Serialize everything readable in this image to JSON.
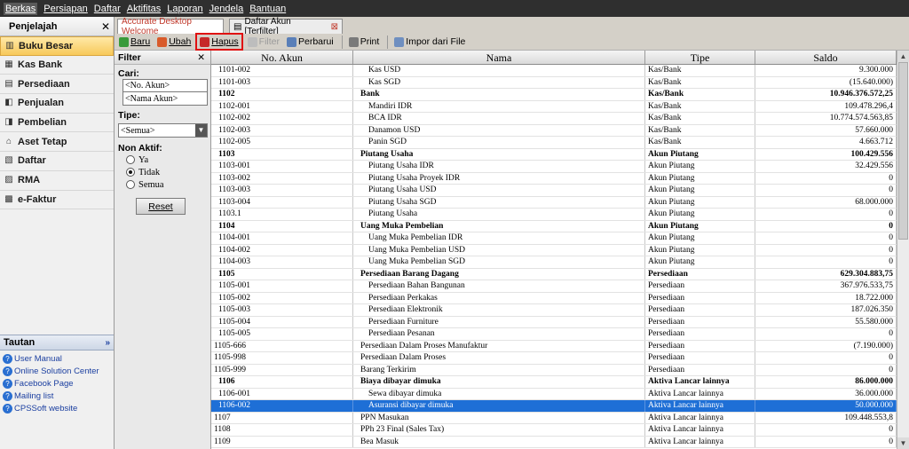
{
  "menu": [
    "Berkas",
    "Persiapan",
    "Daftar",
    "Aktifitas",
    "Laporan",
    "Jendela",
    "Bantuan"
  ],
  "leftnav": {
    "title": "Penjelajah",
    "items": [
      {
        "label": "Buku Besar",
        "icon": "ledger-icon",
        "active": true
      },
      {
        "label": "Kas Bank",
        "icon": "cash-bank-icon"
      },
      {
        "label": "Persediaan",
        "icon": "inventory-icon"
      },
      {
        "label": "Penjualan",
        "icon": "sales-icon"
      },
      {
        "label": "Pembelian",
        "icon": "purchase-icon"
      },
      {
        "label": "Aset Tetap",
        "icon": "fixed-asset-icon"
      },
      {
        "label": "Daftar",
        "icon": "list-icon"
      },
      {
        "label": "RMA",
        "icon": "rma-icon"
      },
      {
        "label": "e-Faktur",
        "icon": "efaktur-icon"
      }
    ],
    "tautan_title": "Tautan",
    "links": [
      "User Manual",
      "Online Solution Center",
      "Facebook Page",
      "Mailing list",
      "CPSSoft website"
    ]
  },
  "tabs": [
    "Accurate Desktop Welcome",
    "Daftar Akun [Terfilter]"
  ],
  "toolbar": {
    "baru": "Baru",
    "ubah": "Ubah",
    "hapus": "Hapus",
    "filter": "Filter",
    "perbarui": "Perbarui",
    "print": "Print",
    "impor": "Impor dari File"
  },
  "filter": {
    "title": "Filter",
    "cari_label": "Cari:",
    "no_akun": "<No. Akun>",
    "nama_akun": "<Nama Akun>",
    "tipe_label": "Tipe:",
    "tipe_value": "<Semua>",
    "nonaktif_label": "Non Aktif:",
    "opt_ya": "Ya",
    "opt_tidak": "Tidak",
    "opt_semua": "Semua",
    "reset": "Reset"
  },
  "grid": {
    "columns": [
      "No. Akun",
      "Nama",
      "Tipe",
      "Saldo"
    ],
    "rows": [
      {
        "no": "1101-002",
        "nama": "Kas USD",
        "tipe": "Kas/Bank",
        "saldo": "9.300.000",
        "lvl": 2
      },
      {
        "no": "1101-003",
        "nama": "Kas SGD",
        "tipe": "Kas/Bank",
        "saldo": "(15.640.000)",
        "lvl": 2
      },
      {
        "no": "1102",
        "nama": "Bank",
        "tipe": "Kas/Bank",
        "saldo": "10.946.376.572,25",
        "lvl": 1,
        "head": true
      },
      {
        "no": "1102-001",
        "nama": "Mandiri IDR",
        "tipe": "Kas/Bank",
        "saldo": "109.478.296,4",
        "lvl": 2
      },
      {
        "no": "1102-002",
        "nama": "BCA IDR",
        "tipe": "Kas/Bank",
        "saldo": "10.774.574.563,85",
        "lvl": 2
      },
      {
        "no": "1102-003",
        "nama": "Danamon USD",
        "tipe": "Kas/Bank",
        "saldo": "57.660.000",
        "lvl": 2
      },
      {
        "no": "1102-005",
        "nama": "Panin SGD",
        "tipe": "Kas/Bank",
        "saldo": "4.663.712",
        "lvl": 2
      },
      {
        "no": "1103",
        "nama": "Piutang Usaha",
        "tipe": "Akun Piutang",
        "saldo": "100.429.556",
        "lvl": 1,
        "head": true
      },
      {
        "no": "1103-001",
        "nama": "Piutang Usaha IDR",
        "tipe": "Akun Piutang",
        "saldo": "32.429.556",
        "lvl": 2
      },
      {
        "no": "1103-002",
        "nama": "Piutang Usaha Proyek IDR",
        "tipe": "Akun Piutang",
        "saldo": "0",
        "lvl": 2
      },
      {
        "no": "1103-003",
        "nama": "Piutang Usaha USD",
        "tipe": "Akun Piutang",
        "saldo": "0",
        "lvl": 2
      },
      {
        "no": "1103-004",
        "nama": "Piutang Usaha SGD",
        "tipe": "Akun Piutang",
        "saldo": "68.000.000",
        "lvl": 2
      },
      {
        "no": "1103.1",
        "nama": "Piutang Usaha",
        "tipe": "Akun Piutang",
        "saldo": "0",
        "lvl": 2
      },
      {
        "no": "1104",
        "nama": "Uang Muka Pembelian",
        "tipe": "Akun Piutang",
        "saldo": "0",
        "lvl": 1,
        "head": true
      },
      {
        "no": "1104-001",
        "nama": "Uang Muka Pembelian IDR",
        "tipe": "Akun Piutang",
        "saldo": "0",
        "lvl": 2
      },
      {
        "no": "1104-002",
        "nama": "Uang Muka Pembelian USD",
        "tipe": "Akun Piutang",
        "saldo": "0",
        "lvl": 2
      },
      {
        "no": "1104-003",
        "nama": "Uang Muka Pembelian SGD",
        "tipe": "Akun Piutang",
        "saldo": "0",
        "lvl": 2
      },
      {
        "no": "1105",
        "nama": "Persediaan Barang Dagang",
        "tipe": "Persediaan",
        "saldo": "629.304.883,75",
        "lvl": 1,
        "head": true
      },
      {
        "no": "1105-001",
        "nama": "Persediaan Bahan Bangunan",
        "tipe": "Persediaan",
        "saldo": "367.976.533,75",
        "lvl": 2
      },
      {
        "no": "1105-002",
        "nama": "Persediaan Perkakas",
        "tipe": "Persediaan",
        "saldo": "18.722.000",
        "lvl": 2
      },
      {
        "no": "1105-003",
        "nama": "Persediaan Elektronik",
        "tipe": "Persediaan",
        "saldo": "187.026.350",
        "lvl": 2
      },
      {
        "no": "1105-004",
        "nama": "Persediaan Furniture",
        "tipe": "Persediaan",
        "saldo": "55.580.000",
        "lvl": 2
      },
      {
        "no": "1105-005",
        "nama": "Persediaan Pesanan",
        "tipe": "Persediaan",
        "saldo": "0",
        "lvl": 2
      },
      {
        "no": "1105-666",
        "nama": "Persediaan Dalam Proses Manufaktur",
        "tipe": "Persediaan",
        "saldo": "(7.190.000)",
        "lvl": 0
      },
      {
        "no": "1105-998",
        "nama": "Persediaan Dalam Proses",
        "tipe": "Persediaan",
        "saldo": "0",
        "lvl": 0
      },
      {
        "no": "1105-999",
        "nama": "Barang Terkirim",
        "tipe": "Persediaan",
        "saldo": "0",
        "lvl": 0
      },
      {
        "no": "1106",
        "nama": "Biaya dibayar dimuka",
        "tipe": "Aktiva Lancar lainnya",
        "saldo": "86.000.000",
        "lvl": 1,
        "head": true
      },
      {
        "no": "1106-001",
        "nama": "Sewa dibayar dimuka",
        "tipe": "Aktiva Lancar lainnya",
        "saldo": "36.000.000",
        "lvl": 2
      },
      {
        "no": "1106-002",
        "nama": "Asuransi dibayar dimuka",
        "tipe": "Aktiva Lancar lainnya",
        "saldo": "50.000.000",
        "lvl": 2,
        "sel": true
      },
      {
        "no": "1107",
        "nama": "PPN Masukan",
        "tipe": "Aktiva Lancar lainnya",
        "saldo": "109.448.553,8",
        "lvl": 0
      },
      {
        "no": "1108",
        "nama": "PPh 23 Final (Sales Tax)",
        "tipe": "Aktiva Lancar lainnya",
        "saldo": "0",
        "lvl": 0
      },
      {
        "no": "1109",
        "nama": "Bea Masuk",
        "tipe": "Aktiva Lancar lainnya",
        "saldo": "0",
        "lvl": 0
      }
    ]
  }
}
